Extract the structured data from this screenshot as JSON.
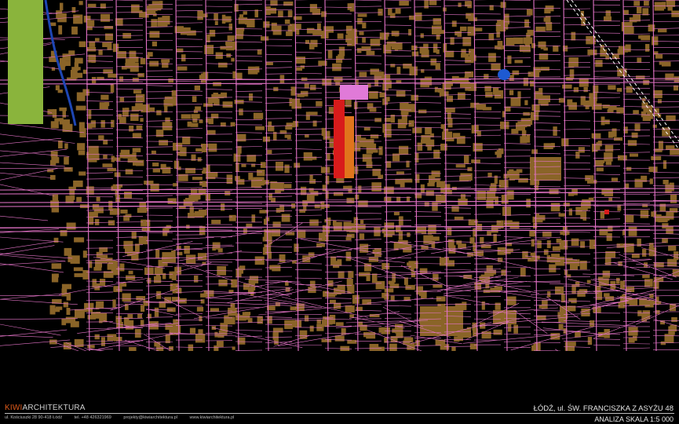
{
  "map": {
    "colors": {
      "background": "#000000",
      "parcel_lines": "#e473c8",
      "buildings": "#8a6428",
      "park": "#8ab43c",
      "river": "#1e46b4",
      "pond": "#1e5ad2",
      "railway": "#ffffff",
      "site_red": "#d81b1b",
      "site_orange": "#e0741c",
      "site_pink": "#e07ad8"
    }
  },
  "footer": {
    "brand_accent": "KIWI",
    "brand_rest": "ARCHITEKTURA",
    "address": "ul. Kościuszki 28 90-418 Łódź",
    "phone": "tel. +48 426321969",
    "email": "projekty@kiwiarchitektura.pl",
    "website": "www.kiwiarchitektura.pl",
    "project_title": "ŁÓDŹ, ul. ŚW. FRANCISZKA Z ASYŻU 48",
    "scale_label": "ANALIZA SKALA 1:5 000"
  }
}
